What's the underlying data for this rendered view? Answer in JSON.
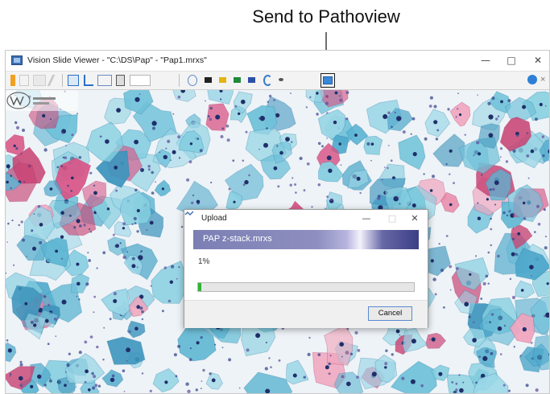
{
  "annotation": {
    "label": "Send to Pathoview"
  },
  "window": {
    "title": "Vision Slide Viewer - \"C:\\DS\\Pap\" - \"Pap1.mrxs\"",
    "controls": {
      "minimize": "—",
      "maximize": "□",
      "close": "✕"
    }
  },
  "toolbar": {
    "icons": [
      "layers-icon",
      "grid-icon",
      "image-dropdown-icon",
      "pen-icon",
      "select-rect-icon",
      "crop-icon",
      "rect-dropdown-icon",
      "save-icon",
      "zoom-field-icon",
      "move-icon",
      "black-marker-icon",
      "yellow-marker-icon",
      "green-marker-icon",
      "blue-marker-icon",
      "rotate-dropdown-icon",
      "dots-dropdown-icon",
      "send-to-pathoview-icon",
      "help-icon",
      "close-panel-icon"
    ]
  },
  "upload_dialog": {
    "title": "Upload",
    "filename": "PAP z-stack.mrxs",
    "percent_label": "1%",
    "progress": 0.01,
    "cancel_label": "Cancel",
    "controls": {
      "minimize": "—",
      "maximize": "□",
      "close": "✕"
    }
  },
  "colors": {
    "accent": "#3a6fb0",
    "progress": "#2fb534",
    "cell_cyan": "#52aac6",
    "cell_pink": "#dd5a86",
    "nucleus": "#1f2f6a"
  }
}
